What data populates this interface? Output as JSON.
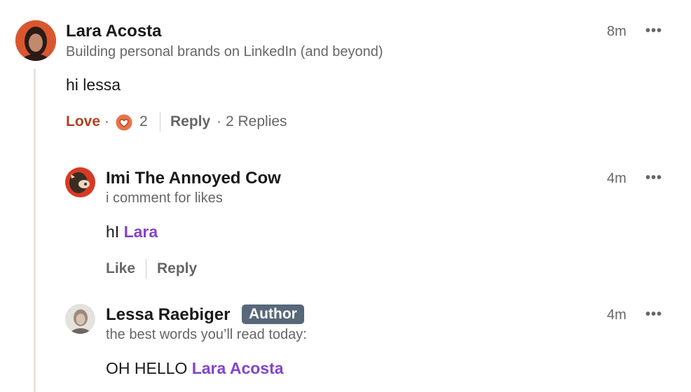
{
  "comment": {
    "author": "Lara Acosta",
    "headline": "Building personal brands on LinkedIn (and beyond)",
    "time": "8m",
    "more": "•••",
    "text": "hi lessa",
    "reaction_label": "Love",
    "sep1": "·",
    "reaction_count": "2",
    "reply_label": "Reply",
    "sep2": "·",
    "replies_count": "2 Replies"
  },
  "replies": [
    {
      "author": "Imi The Annoyed Cow",
      "headline": "i comment for likes",
      "time": "4m",
      "more": "•••",
      "text_prefix": "hI ",
      "mention": "Lara",
      "like_label": "Like",
      "reply_label": "Reply"
    },
    {
      "author": "Lessa Raebiger",
      "badge": "Author",
      "headline": "the best words you’ll read today:",
      "time": "4m",
      "more": "•••",
      "text_prefix": "OH HELLO ",
      "mention": "Lara Acosta"
    }
  ],
  "colors": {
    "love": "#b24020",
    "mention": "#8344cc",
    "badge_bg": "#56687a",
    "thread_line": "#e8e4dc"
  }
}
